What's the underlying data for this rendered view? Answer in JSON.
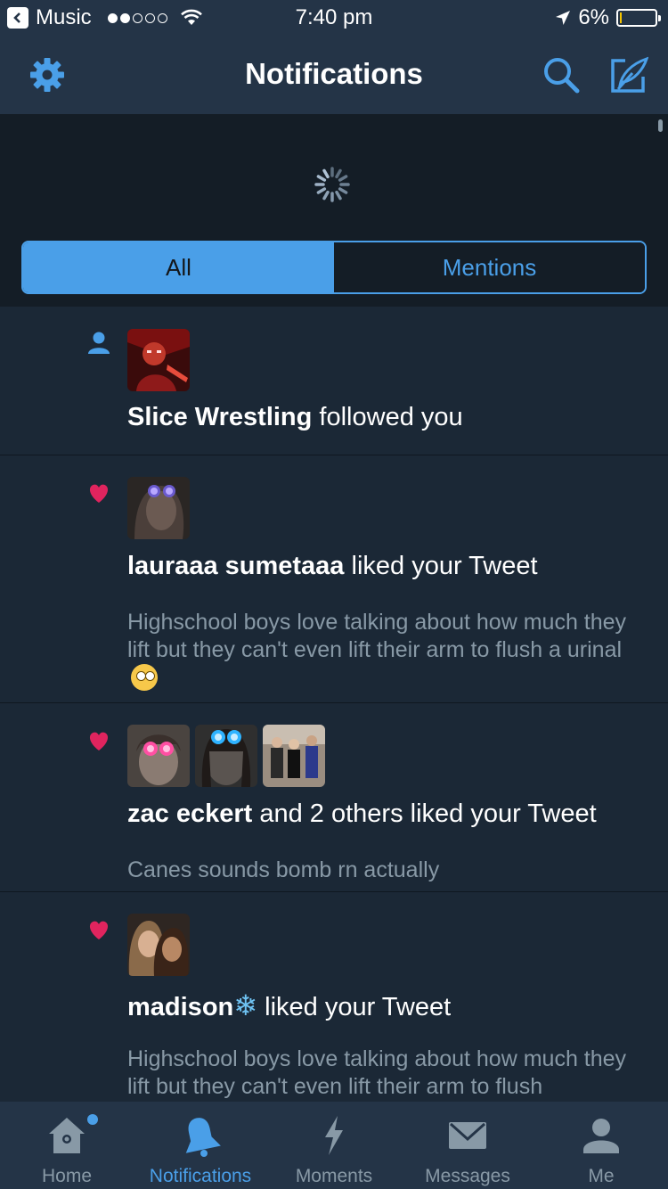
{
  "status_bar": {
    "back_app": "Music",
    "time": "7:40 pm",
    "battery": "6%",
    "battery_level": 0.06,
    "signal_bars": 2
  },
  "nav": {
    "title": "Notifications",
    "icons": {
      "left": "gear-icon",
      "search": "search-icon",
      "compose": "compose-icon"
    }
  },
  "segments": {
    "all": "All",
    "mentions": "Mentions",
    "selected": "All"
  },
  "notifications": [
    {
      "type": "follow",
      "icon": "person-icon",
      "name": "Slice Wrestling",
      "action": " followed you",
      "tweet": ""
    },
    {
      "type": "like",
      "icon": "heart-icon",
      "name": "lauraaa sumetaaa",
      "action": " liked your Tweet",
      "tweet": "Highschool boys love talking about how much they lift but they can't even lift their arm to flush a urinal"
    },
    {
      "type": "like",
      "icon": "heart-icon",
      "name": "zac eckert",
      "action": " and 2 others liked your Tweet",
      "tweet": "Canes sounds bomb rn actually"
    },
    {
      "type": "like",
      "icon": "heart-icon",
      "name": "madison",
      "name_emoji": "❄",
      "action": " liked your Tweet",
      "tweet": "Highschool boys love talking about how much they lift but they can't even lift their arm to flush"
    }
  ],
  "tabs": [
    {
      "label": "Home",
      "icon": "home-icon"
    },
    {
      "label": "Notifications",
      "icon": "bell-icon",
      "active": true
    },
    {
      "label": "Moments",
      "icon": "lightning-icon"
    },
    {
      "label": "Messages",
      "icon": "envelope-icon"
    },
    {
      "label": "Me",
      "icon": "profile-icon"
    }
  ],
  "colors": {
    "accent": "#4a9fe8",
    "background": "#1b2836",
    "bar": "#243447",
    "like": "#e0245e",
    "secondary_text": "#8899a6"
  }
}
